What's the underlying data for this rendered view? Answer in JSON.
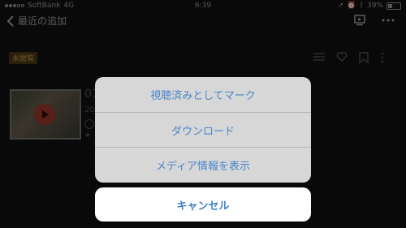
{
  "status_bar": {
    "carrier": "SoftBank",
    "network": "4G",
    "time": "6:39",
    "battery_percent": "39%",
    "battery_level": 0.39
  },
  "nav": {
    "back_label": "最近の追加",
    "icons": [
      "back-chevron-icon",
      "airplay-icon",
      "more-icon"
    ]
  },
  "content": {
    "badge": "未閲覧",
    "tool_icons": [
      "list-icon",
      "heart-icon",
      "bookmark-icon",
      "more-vertical-icon"
    ],
    "partial_title": "01",
    "partial_date": "20",
    "partial_meta": "★"
  },
  "action_sheet": {
    "items": [
      {
        "label": "視聴済みとしてマーク"
      },
      {
        "label": "ダウンロード"
      },
      {
        "label": "メディア情報を表示"
      }
    ],
    "cancel_label": "キャンセル"
  },
  "colors": {
    "accent": "#4a86c8",
    "badge_bg": "#4a3b16",
    "badge_text": "#c9a34a"
  }
}
